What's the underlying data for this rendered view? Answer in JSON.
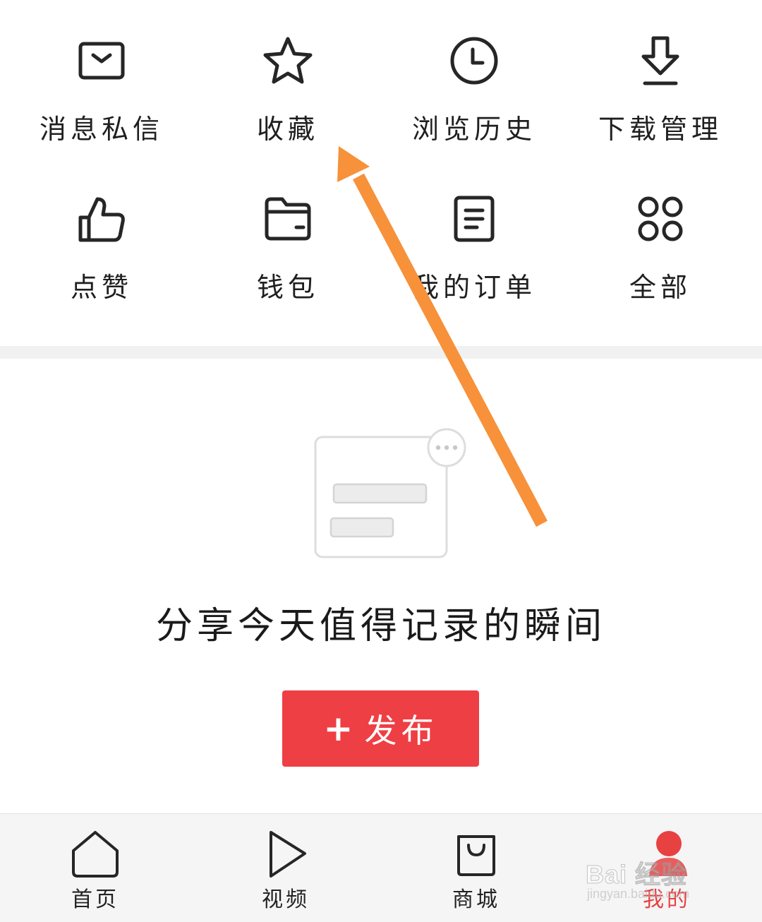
{
  "grid": {
    "items": [
      {
        "label": "消息私信",
        "icon": "message-icon"
      },
      {
        "label": "收藏",
        "icon": "star-icon"
      },
      {
        "label": "浏览历史",
        "icon": "clock-icon"
      },
      {
        "label": "下载管理",
        "icon": "download-icon"
      },
      {
        "label": "点赞",
        "icon": "thumbs-up-icon"
      },
      {
        "label": "钱包",
        "icon": "wallet-icon"
      },
      {
        "label": "我的订单",
        "icon": "order-icon"
      },
      {
        "label": "全部",
        "icon": "grid-icon"
      }
    ]
  },
  "empty_state": {
    "title": "分享今天值得记录的瞬间",
    "publish_plus": "+",
    "publish_label": "发布"
  },
  "bottom_nav": {
    "items": [
      {
        "label": "首页",
        "icon": "home-icon"
      },
      {
        "label": "视频",
        "icon": "play-icon"
      },
      {
        "label": "商城",
        "icon": "shopping-bag-icon"
      },
      {
        "label": "我的",
        "icon": "profile-icon",
        "active": true
      }
    ]
  },
  "watermark": {
    "main": "Bai 经验",
    "sub": "jingyan.baidu.com"
  },
  "colors": {
    "accent": "#ee3f44",
    "arrow": "#f7913a",
    "icon_stroke": "#262626",
    "divider": "#f1f1f1",
    "nav_bg": "#f5f5f5"
  }
}
